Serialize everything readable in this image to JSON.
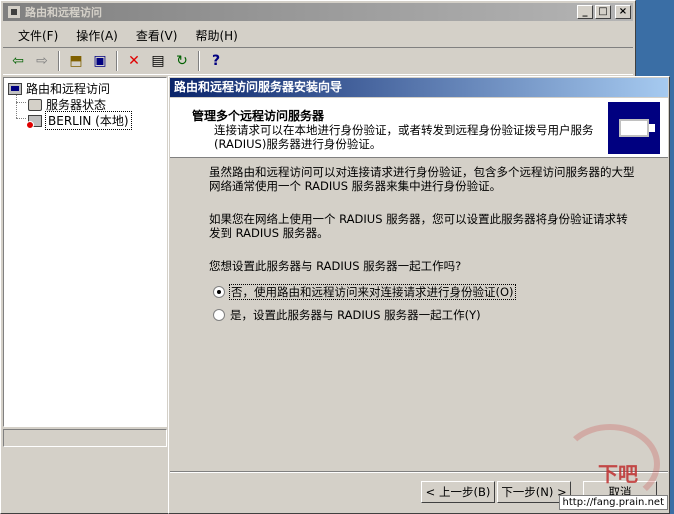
{
  "main_window": {
    "title": "路由和远程访问",
    "controls": {
      "minimize": "_",
      "maximize": "□",
      "close": "×"
    }
  },
  "menu": [
    "文件(F)",
    "操作(A)",
    "查看(V)",
    "帮助(H)"
  ],
  "toolbar": {
    "icons": [
      "back-arrow-icon",
      "forward-arrow-icon",
      "up-folder-icon",
      "show-hide-tree-icon",
      "delete-icon",
      "properties-icon",
      "refresh-icon",
      "help-icon"
    ],
    "glyphs": [
      "⇦",
      "⇨",
      "⬒",
      "▣",
      "✕",
      "▤",
      "↻",
      "?"
    ]
  },
  "tree": {
    "root": "路由和远程访问",
    "items": [
      "服务器状态",
      "BERLIN (本地)"
    ]
  },
  "wizard": {
    "title": "路由和远程访问服务器安装向导",
    "header_title": "管理多个远程访问服务器",
    "header_subtitle": "连接请求可以在本地进行身份验证，或者转发到远程身份验证拨号用户服务(RADIUS)服务器进行身份验证。",
    "paragraph1": "虽然路由和远程访问可以对连接请求进行身份验证，包含多个远程访问服务器的大型网络通常使用一个 RADIUS 服务器来集中进行身份验证。",
    "paragraph2": "如果您在网络上使用一个 RADIUS 服务器，您可以设置此服务器将身份验证请求转发到 RADIUS 服务器。",
    "question": "您想设置此服务器与 RADIUS 服务器一起工作吗?",
    "options": [
      {
        "label": "否，使用路由和远程访问来对连接请求进行身份验证(O)",
        "selected": true
      },
      {
        "label": "是，设置此服务器与 RADIUS 服务器一起工作(Y)",
        "selected": false
      }
    ],
    "buttons": {
      "back": "< 上一步(B)",
      "next": "下一步(N) >",
      "cancel": "取消"
    }
  },
  "watermark": {
    "text": "下吧",
    "url": "http://fang.prain.net"
  }
}
